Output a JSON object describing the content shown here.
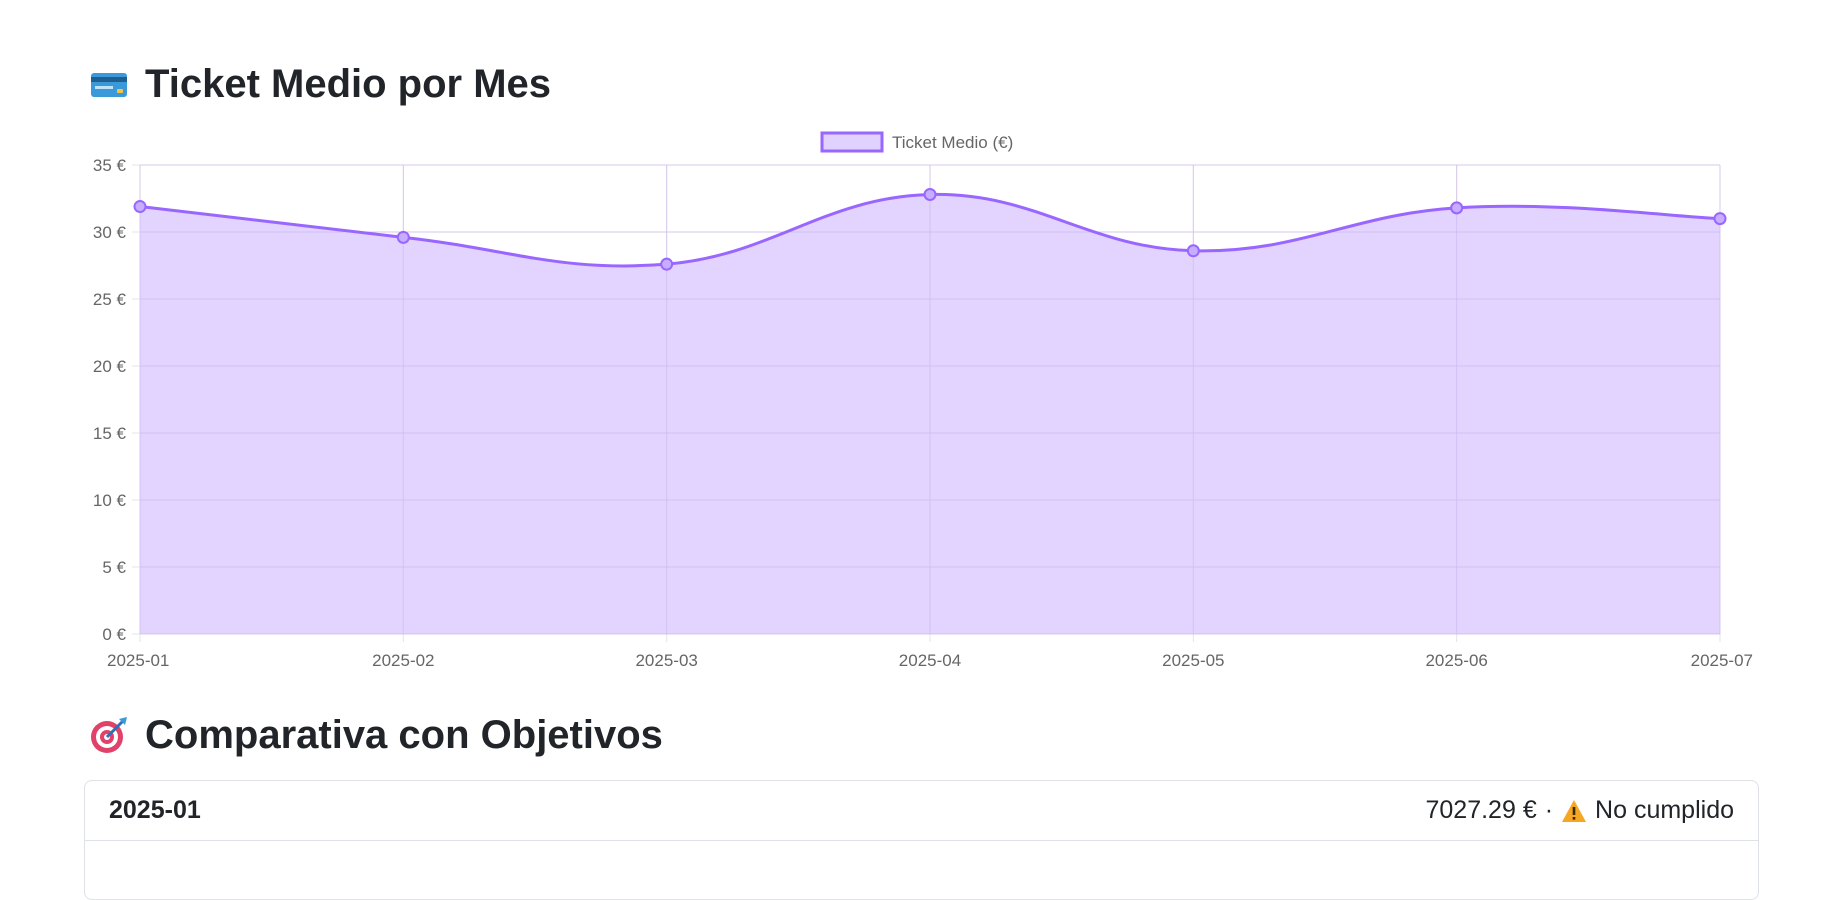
{
  "sections": {
    "ticket": {
      "title": "Ticket Medio por Mes",
      "icon": "credit-card-icon"
    },
    "goals": {
      "title": "Comparativa con Objetivos",
      "icon": "target-icon"
    }
  },
  "colors": {
    "line": "#9966ff",
    "fill": "#e0d1ff",
    "grid": "#e5e5e5",
    "tick": "#666666"
  },
  "chart_data": {
    "type": "area",
    "categories": [
      "2025-01",
      "2025-02",
      "2025-03",
      "2025-04",
      "2025-05",
      "2025-06",
      "2025-07"
    ],
    "series": [
      {
        "name": "Ticket Medio (€)",
        "values": [
          31.9,
          29.6,
          27.6,
          32.8,
          28.6,
          31.8,
          31.0
        ]
      }
    ],
    "yticks": [
      "0 €",
      "5 €",
      "10 €",
      "15 €",
      "20 €",
      "25 €",
      "30 €",
      "35 €"
    ],
    "ylim": [
      0,
      35
    ],
    "grid": true,
    "legend": "top-center",
    "curve": "smooth"
  },
  "goals": [
    {
      "month": "2025-01",
      "amount": "7027.29 €",
      "separator": "·",
      "status": "No cumplido",
      "status_icon": "warning-icon"
    }
  ]
}
